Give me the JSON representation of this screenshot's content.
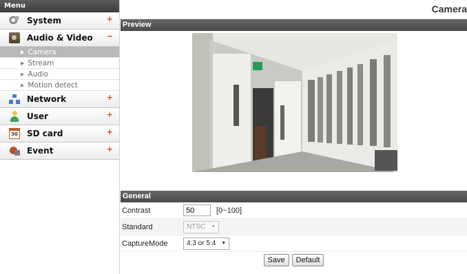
{
  "menu": {
    "title": "Menu",
    "categories": [
      {
        "label": "System",
        "toggle": "+",
        "icon": "gear-icon"
      },
      {
        "label": "Audio & Video",
        "toggle": "−",
        "icon": "camera-icon",
        "items": [
          "Camera",
          "Stream",
          "Audio",
          "Motion detect"
        ]
      },
      {
        "label": "Network",
        "toggle": "+",
        "icon": "network-icon"
      },
      {
        "label": "User",
        "toggle": "+",
        "icon": "user-icon"
      },
      {
        "label": "SD card",
        "toggle": "+",
        "icon": "sd-card-icon",
        "icon_text": "30"
      },
      {
        "label": "Event",
        "toggle": "+",
        "icon": "event-icon"
      }
    ],
    "active_item": "Camera"
  },
  "page": {
    "title": "Camera"
  },
  "preview": {
    "section_title": "Preview"
  },
  "general": {
    "section_title": "General",
    "contrast": {
      "label": "Contrast",
      "value": "50",
      "range": "[0~100]"
    },
    "standard": {
      "label": "Standard",
      "value": "NTSC",
      "disabled": true
    },
    "capture_mode": {
      "label": "CaptureMode",
      "value": "4:3 or 5:4"
    }
  },
  "buttons": {
    "save": "Save",
    "default": "Default"
  },
  "colors": {
    "toggle": "#d9441b",
    "section_bar": "#555555",
    "active_item_bg": "#b9b9b9"
  }
}
